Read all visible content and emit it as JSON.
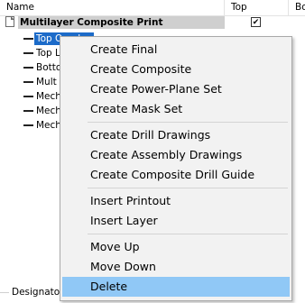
{
  "columns": {
    "name": "Name",
    "top": "Top",
    "bottom": "Bo"
  },
  "root": {
    "label": "Multilayer Composite Print",
    "top_checked": "✔"
  },
  "children": [
    {
      "label": "Top Overlay",
      "selected": true
    },
    {
      "label": "Top L",
      "selected": false
    },
    {
      "label": "Botto",
      "selected": false
    },
    {
      "label": "Mult",
      "selected": false
    },
    {
      "label": "Mech",
      "selected": false
    },
    {
      "label": "Mech",
      "selected": false
    },
    {
      "label": "Mech",
      "selected": false
    }
  ],
  "designator_label": "Designato",
  "menu": {
    "groups": [
      [
        "Create Final",
        "Create Composite",
        "Create Power-Plane Set",
        "Create Mask Set"
      ],
      [
        "Create Drill Drawings",
        "Create Assembly Drawings",
        "Create Composite Drill Guide"
      ],
      [
        "Insert Printout",
        "Insert Layer"
      ],
      [
        "Move Up",
        "Move Down",
        "Delete"
      ]
    ],
    "highlighted": "Delete"
  }
}
